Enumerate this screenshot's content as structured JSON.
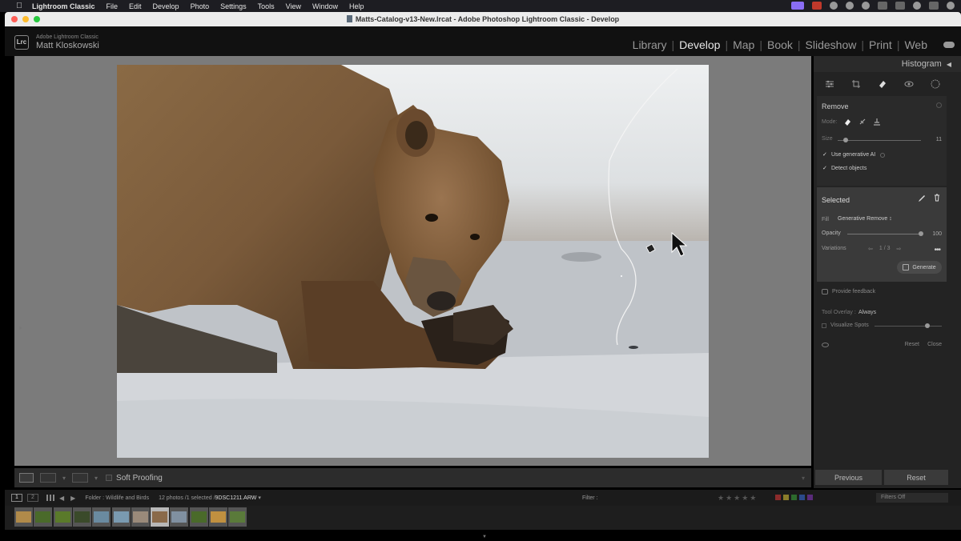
{
  "menubar": {
    "app": "Lightroom Classic",
    "items": [
      "File",
      "Edit",
      "Develop",
      "Photo",
      "Settings",
      "Tools",
      "View",
      "Window",
      "Help"
    ]
  },
  "window": {
    "title": "Matts-Catalog-v13-New.lrcat - Adobe Photoshop Lightroom Classic - Develop"
  },
  "identity": {
    "badge": "Lrc",
    "product": "Adobe Lightroom Classic",
    "user": "Matt Kloskowski"
  },
  "modules": [
    "Library",
    "Develop",
    "Map",
    "Book",
    "Slideshow",
    "Print",
    "Web"
  ],
  "active_module": "Develop",
  "right_panel": {
    "histogram_label": "Histogram",
    "remove": {
      "title": "Remove",
      "mode_label": "Mode:",
      "size_label": "Size",
      "size_value": "11",
      "size_fraction": 0.1,
      "use_gen_ai": "Use generative AI",
      "detect_objects": "Detect objects"
    },
    "selected": {
      "title": "Selected",
      "fill_label": "Fill",
      "fill_value": "Generative Remove ↕",
      "opacity_label": "Opacity",
      "opacity_value": "100",
      "opacity_fraction": 1.0,
      "variations_label": "Variations",
      "variations_value": "1 / 3",
      "generate_label": "Generate"
    },
    "feedback": "Provide feedback",
    "tool_overlay_label": "Tool Overlay :",
    "tool_overlay_value": "Always",
    "visualize_spots": "Visualize Spots",
    "visualize_fraction": 0.78,
    "reset_link": "Reset",
    "close_link": "Close",
    "previous_btn": "Previous",
    "reset_btn": "Reset"
  },
  "toolbar": {
    "soft_proofing": "Soft Proofing"
  },
  "filmstrip_bar": {
    "monitor1": "1",
    "monitor2": "2",
    "folder": "Folder : Wildlife and Birds",
    "count": "12 photos /1 selected /",
    "filename": "9DSC1211.ARW",
    "filter_label": "Filter :",
    "filters_off": "Filters Off"
  },
  "accent_colors": {
    "swatches": [
      "#8b2b2b",
      "#8a7c2a",
      "#2d6a2d",
      "#2b4a8a",
      "#5a2b7a"
    ]
  },
  "filmstrip": {
    "thumbs": [
      {
        "color": "#b08a4a"
      },
      {
        "color": "#4a6a2a"
      },
      {
        "color": "#5a7a2a"
      },
      {
        "color": "#3a4a2a"
      },
      {
        "color": "#6a8aa0"
      },
      {
        "color": "#7a9ab0"
      },
      {
        "color": "#9a8a7a"
      },
      {
        "color": "#8a6a4a",
        "selected": true
      },
      {
        "color": "#8090a0"
      },
      {
        "color": "#4a6a2a"
      },
      {
        "color": "#c09040"
      },
      {
        "color": "#5a7a3a"
      }
    ]
  }
}
